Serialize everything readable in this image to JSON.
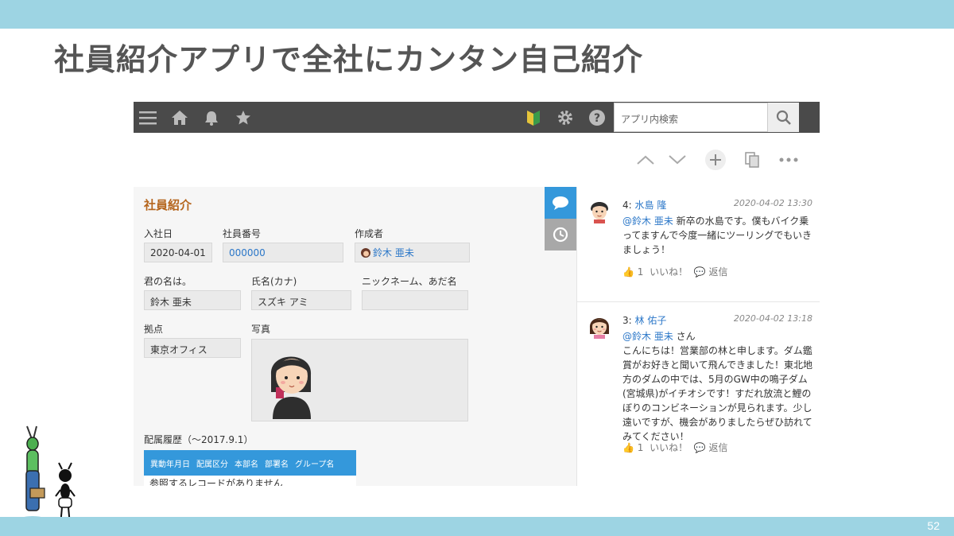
{
  "slide": {
    "title": "社員紹介アプリで全社にカンタン自己紹介",
    "page_number": "52"
  },
  "colors": {
    "band": "#9dd4e3",
    "appbar": "#4a4a4a",
    "accent_title": "#b5651d",
    "link": "#2b77c8",
    "table_header": "#3498db"
  },
  "appbar": {
    "icons": [
      "menu-icon",
      "home-icon",
      "bell-icon",
      "star-icon",
      "beginner-mark-icon",
      "gear-icon",
      "help-icon"
    ],
    "search_placeholder": "アプリ内検索"
  },
  "toolbar": {
    "icons": [
      "chevron-up-icon",
      "chevron-down-icon",
      "plus-icon",
      "copy-icon",
      "more-icon"
    ]
  },
  "record": {
    "title": "社員紹介",
    "fields": {
      "hire_date": {
        "label": "入社日",
        "value": "2020-04-01"
      },
      "employee_no": {
        "label": "社員番号",
        "value": "000000"
      },
      "creator": {
        "label": "作成者",
        "value": "鈴木 亜未"
      },
      "name": {
        "label": "君の名は。",
        "value": "鈴木 亜未"
      },
      "kana": {
        "label": "氏名(カナ)",
        "value": "スズキ アミ"
      },
      "nickname": {
        "label": "ニックネーム、あだ名",
        "value": ""
      },
      "office": {
        "label": "拠点",
        "value": "東京オフィス"
      },
      "photo": {
        "label": "写真"
      }
    },
    "history": {
      "label": "配属履歴（～2017.9.1）",
      "columns": [
        "異動年月日",
        "配属区分",
        "本部名",
        "部署名",
        "グループ名"
      ],
      "empty_text": "参照するレコードがありません"
    }
  },
  "comments": [
    {
      "number": "4:",
      "author": "水島 隆",
      "date": "2020-04-02 13:30",
      "mention": "@鈴木 亜未",
      "text": "新卒の水島です。僕もバイク乗ってますんで今度一緒にツーリングでもいきましょう！",
      "likes": "1",
      "like_label": "いいね！",
      "reply_label": "返信"
    },
    {
      "number": "3:",
      "author": "林 佑子",
      "date": "2020-04-02 13:18",
      "mention": "@鈴木 亜未",
      "mention_suffix": "さん",
      "text": "こんにちは！営業部の林と申します。ダム鑑賞がお好きと聞いて飛んできました！東北地方のダムの中では、5月のGW中の鳴子ダム(宮城県)がイチオシです！すだれ放流と鯉のぼりのコンビネーションが見られます。少し遠いですが、機会がありましたらぜひ訪れてみてください！",
      "likes": "1",
      "like_label": "いいね！",
      "reply_label": "返信"
    }
  ]
}
